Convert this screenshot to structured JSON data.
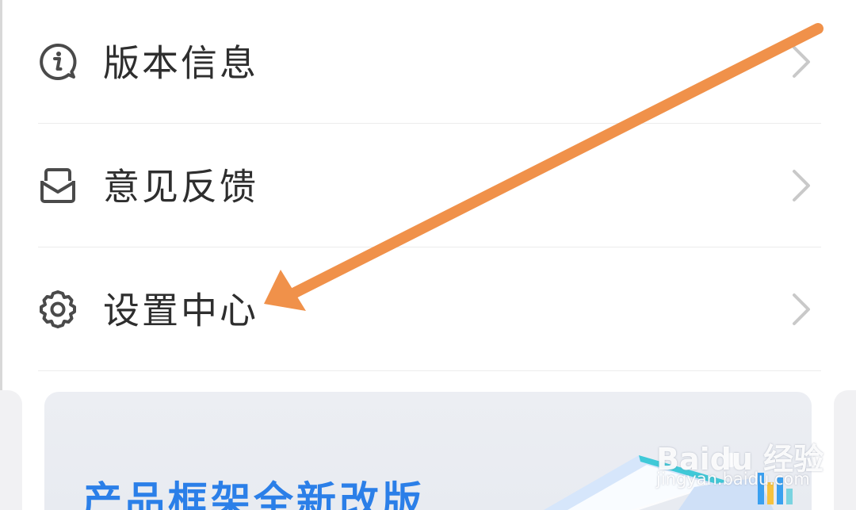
{
  "menu": {
    "items": [
      {
        "label": "版本信息",
        "icon": "info-bubble-icon"
      },
      {
        "label": "意见反馈",
        "icon": "feedback-envelope-icon"
      },
      {
        "label": "设置中心",
        "icon": "gear-icon"
      }
    ]
  },
  "banner": {
    "title": "产品框架全新改版"
  },
  "watermark": {
    "logo_text": "Baidu 经验",
    "url_text": "jingyan.baidu.com"
  },
  "colors": {
    "annotation_arrow": "#f0914a",
    "banner_title": "#2b7fe8",
    "label_text": "#2e2e2e",
    "icon_stroke": "#4a4a4a",
    "chevron": "#c9c9c9"
  }
}
